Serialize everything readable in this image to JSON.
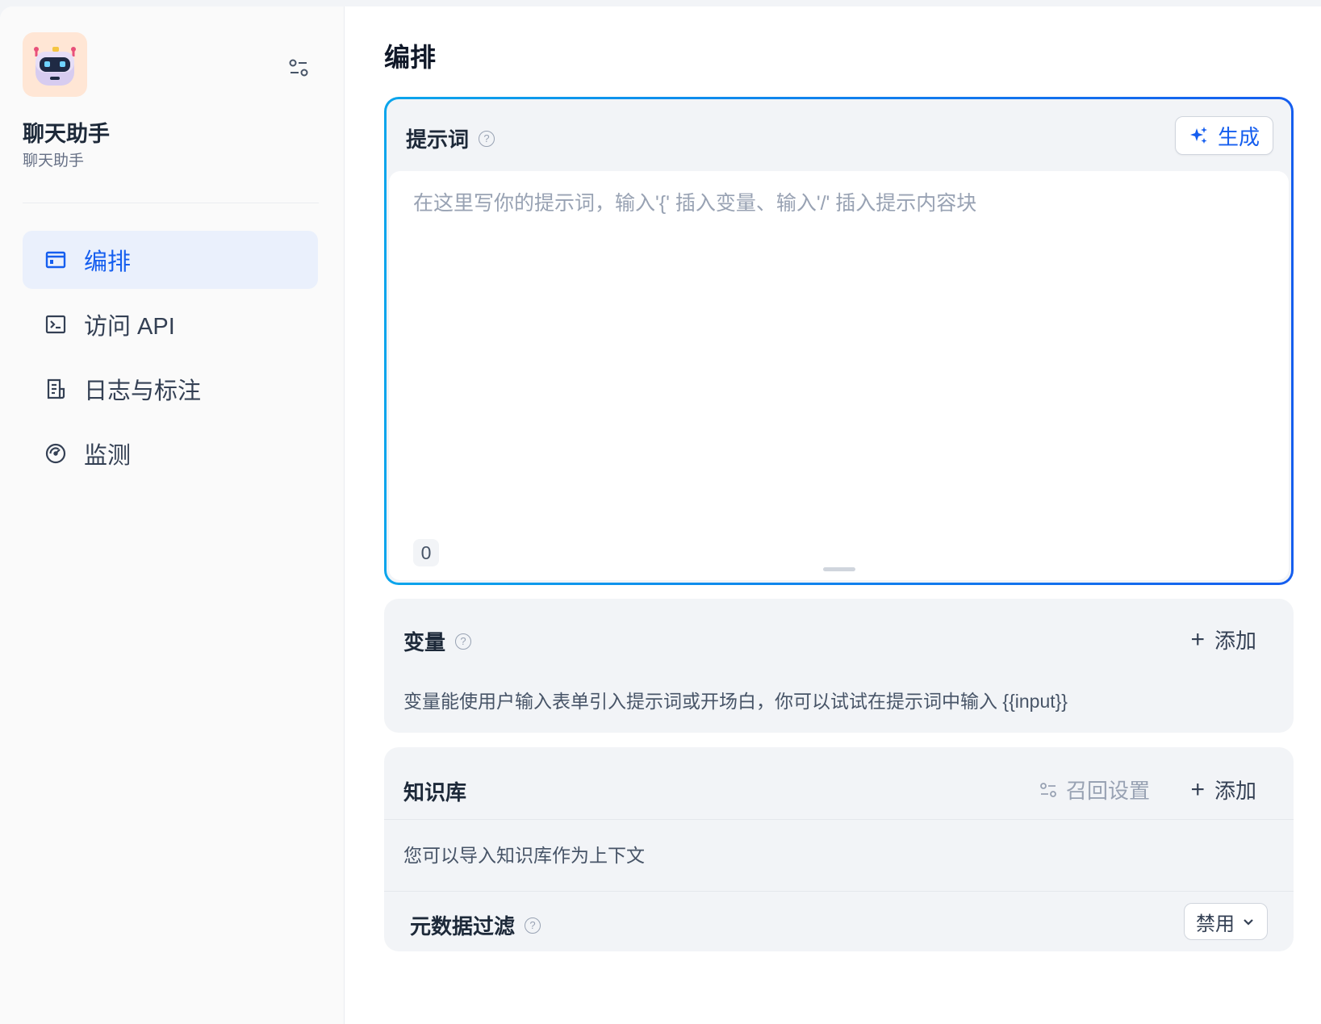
{
  "app": {
    "name": "聊天助手",
    "description": "聊天助手"
  },
  "sidebar": {
    "items": [
      {
        "label": "编排",
        "icon": "layout-window-icon",
        "active": true
      },
      {
        "label": "访问 API",
        "icon": "terminal-icon",
        "active": false
      },
      {
        "label": "日志与标注",
        "icon": "file-list-icon",
        "active": false
      },
      {
        "label": "监测",
        "icon": "dashboard-gauge-icon",
        "active": false
      }
    ]
  },
  "main": {
    "title": "编排",
    "prompt": {
      "title": "提示词",
      "generate_label": "生成",
      "placeholder": "在这里写你的提示词，输入'{' 插入变量、输入'/' 插入提示内容块",
      "value": "",
      "char_count": "0"
    },
    "variables": {
      "title": "变量",
      "add_label": "添加",
      "description": "变量能使用户输入表单引入提示词或开场白，你可以试试在提示词中输入 {{input}}"
    },
    "knowledge": {
      "title": "知识库",
      "recall_label": "召回设置",
      "add_label": "添加",
      "description": "您可以导入知识库作为上下文",
      "metadata_filter": {
        "title": "元数据过滤",
        "selected": "禁用"
      }
    }
  },
  "colors": {
    "accent": "#155eef",
    "gradient_start": "#0ba5ec",
    "active_nav_bg": "#eaf0fc",
    "app_icon_bg": "#ffe6d5"
  }
}
